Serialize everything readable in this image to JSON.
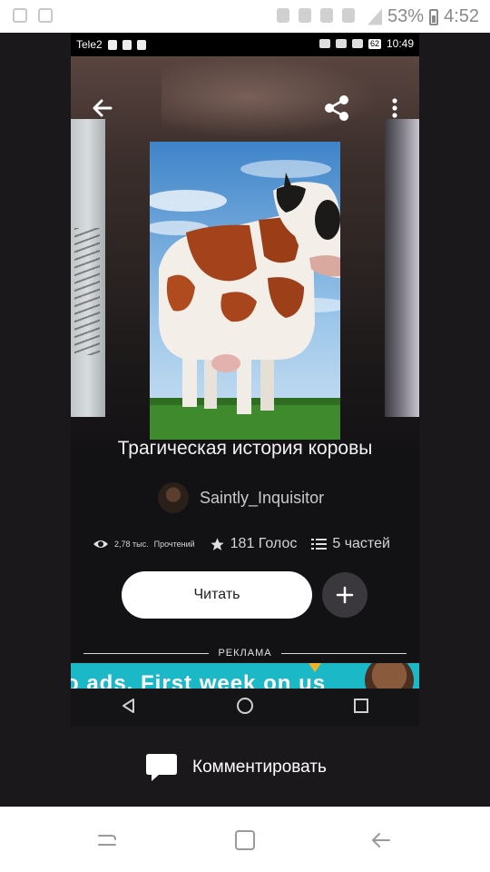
{
  "outer_status": {
    "battery": "53%",
    "time": "4:52"
  },
  "inner_status": {
    "carrier": "Tele2",
    "battery": "62",
    "time": "10:49"
  },
  "story": {
    "title": "Трагическая история коровы",
    "author": "Saintly_Inquisitor",
    "reads_value": "2,78 тыс.",
    "reads_label": "Прочтений",
    "votes": "181 Голос",
    "parts": "5 частей"
  },
  "actions": {
    "read_label": "Читать"
  },
  "ad": {
    "label": "РЕКЛАМА",
    "text": "o ads. First week on us"
  },
  "comment": {
    "label": "Комментировать"
  },
  "icons": {
    "back": "arrow-left-icon",
    "share": "share-icon",
    "more": "more-vertical-icon",
    "eye": "eye-icon",
    "star": "star-icon",
    "list": "list-icon",
    "plus": "plus-icon",
    "comment": "speech-bubble-icon"
  },
  "colors": {
    "accent": "#1bb8c7",
    "background": "#121113",
    "button": "#ffffff"
  }
}
